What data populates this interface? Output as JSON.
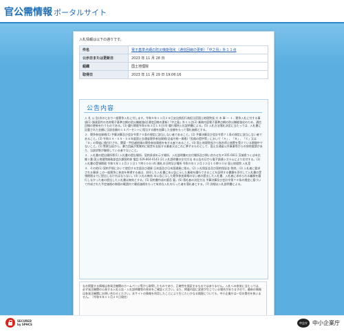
{
  "header": {
    "title_main": "官公需情報",
    "title_sub": "ポータルサイト"
  },
  "intro": "入札情報は以下の通りです。",
  "info": [
    {
      "label": "件名",
      "value": "電子基準点網の防災機能強化（通信回線の更新）「中之島」外１１点"
    },
    {
      "label": "公示日または更新日",
      "value": "2023 年 11 月 28 日"
    },
    {
      "label": "組織",
      "value": "国土地理院"
    },
    {
      "label": "取得日",
      "value": "2023 年 11 月 29 日 19:06:16"
    }
  ],
  "notice": {
    "title": "公告内容",
    "paragraphs": [
      "入 札 公 告(次のとおり一般競争入札に付します。令和５年１１月２８日支出負担行為担当官国土地理院長 大 木 章 一 １．競争入札に付する事項(1) 調達案件の名称電子基準点網の防災機能強化(通信回線の更新)「中之島」外１１点(2) 業務内容電子基準点網の防災機能強化のため、通信回線の更新を行うものである。(3) 履行期限令和６年３月１５日(4) 履行場所入札説明書による。(5) 入札方法落札決定に当たっては、入札書に記載された金額に当該金額の１０パーセントに相当する額を加算した金額をもって落札価格とする。",
      "２．競争参加資格(1) 予算決算及び会計令第７０条の規定に該当しない者であること。(2) 予算決算及び会計令第７１条の規定に該当しない者であること。(3) 令和０４・０５・０６年度国土交通省競争参加資格(全省庁統一資格)「役務の提供等」において「Ａ」、「Ｂ」、「Ｃ」又は「Ｄ」の等級に格付けされ、関東・甲信越地域の競争参加資格を有する者であること。(4) 国土地理院長から指名停止措置を受けている期間中でないこと。(5) 警察当局から、暴力団員が実質的に経営を支配する業者又はこれに準ずるものとして、国土交通省公共事業等からの排除要請があり、当該状態が継続している者でないこと。",
      "３．入札書の提出場所等(1) 入札書の提出場所、契約条項を示す場所、入札説明書の交付場所及び問い合わせ先〒305-0811 茨城県つくば市北郷１番 国土地理院総務部会計課契約係 電話 029-864-6143 (2) 入札説明書の交付方法 本公告の日から電子調達システムにより交付する。(3) 入札書の受領期限 令和５年１２月２１日１７時００分 (4) 開札の日時及び場所 令和５年１２月２２日１０時００分 国土地理院 入札室",
      "４．その他(1) 契約手続において使用する言語及び通貨 日本語及び日本国通貨に限る。(2) 入札保証金及び契約保証金 免除。(3) 入札者に要求される事項 この一般競争に参加を希望する者は、封印した入札書に本公告に示した業務を履行できることを証明する書類を添付して入札書の受領期限までに提出しなければならない。(4) 入札の無効 本公告に示した競争参加資格のない者の提出した入札書、入札者に求められる義務を履行しなかった者の提出した入札書は無効とする。(5) 契約書作成の要否 要。(6) 落札者の決定方法 予算決算及び会計令第７９条の規定に基づいて作成された予定価格の制限の範囲内で最低価格をもって有効な入札を行った者を落札者とする。(7) 詳細は入札説明書による。"
    ]
  },
  "disclaimer": "なお掲載する情報は各発注機関のホームページ等から取得したものであり、正確性を保証するものではありません。入札への参加に当たっては、必ず発注機関の公表する入札公告・入札説明書等の原本をご確認ください。また、掲載内容に変更が生じている場合がありますので、最新の情報は各発注機関にお問い合わせください。本サイトの情報を利用したことにより生じたいかなる損害についても、中小企業庁は一切の責任を負いません。（令和５年１１月２９日現在）",
  "footer": {
    "secure_line1": "SECURED",
    "secure_line2": "by SPHCS",
    "agency_mark": "中企庁",
    "agency_name": "中小企業庁"
  },
  "colors": {
    "background": "#5aaee0",
    "brand": "#1f6fb8",
    "link": "#1a56b0"
  }
}
